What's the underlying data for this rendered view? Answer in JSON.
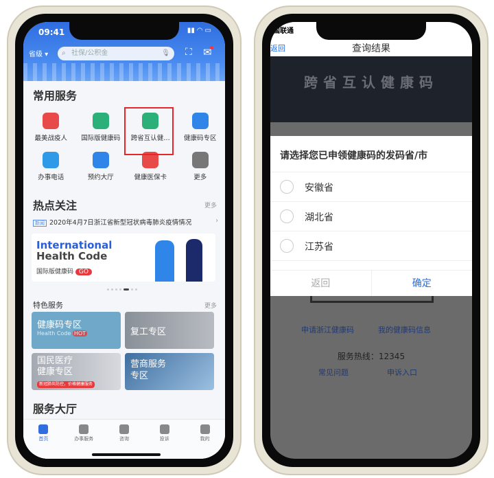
{
  "left": {
    "status_time": "09:41",
    "region": "省级",
    "search_placeholder": "社保/公积金",
    "common_title": "常用服务",
    "services": [
      {
        "label": "最美战疫人",
        "icon": "medal-icon",
        "color": "#e84a4a"
      },
      {
        "label": "国际版健康码",
        "icon": "qr-code-icon",
        "color": "#2bb07a"
      },
      {
        "label": "跨省互认健…",
        "icon": "qr-shield-icon",
        "color": "#2bb07a",
        "highlighted": true
      },
      {
        "label": "健康码专区",
        "icon": "qr-code-blue-icon",
        "color": "#2f86e8"
      },
      {
        "label": "办事电话",
        "icon": "clipboard-icon",
        "color": "#2f9ae8"
      },
      {
        "label": "预约大厅",
        "icon": "building-clock-icon",
        "color": "#2f86e8"
      },
      {
        "label": "健康医保卡",
        "icon": "heart-pulse-icon",
        "color": "#e84a4a"
      },
      {
        "label": "更多",
        "icon": "grid-icon",
        "color": "#777"
      }
    ],
    "hot_title": "热点关注",
    "more": "更多",
    "news_tag": "新闻",
    "news_text": "2020年4月7日浙江省新型冠状病毒肺炎疫情情况",
    "banner": {
      "line1": "International",
      "line2": "Health Code",
      "sub": "国际版健康码",
      "go": "GO"
    },
    "carousel_active": 5,
    "carousel_count": 7,
    "featured_title": "特色服务",
    "cards": [
      {
        "title": "健康码专区",
        "sub": "Health Code",
        "badge": "HOT"
      },
      {
        "title": "复工专区"
      },
      {
        "title": "国民医疗\n健康专区",
        "badge": "新冠肺炎防控，价格健康服务"
      },
      {
        "title": "营商服务\n专区"
      }
    ],
    "hall_title": "服务大厅",
    "tabs": [
      "首页",
      "办事服务",
      "咨询",
      "投诉",
      "我的"
    ],
    "highlight_color": "#e8262a",
    "accent": "#2f6de0"
  },
  "right": {
    "carrier": "国联通",
    "back": "返回",
    "title": "查询结果",
    "banner_text": "跨省互认健康码",
    "dialog_title": "请选择您已申领健康码的发码省/市",
    "options": [
      "安徽省",
      "湖北省",
      "江苏省"
    ],
    "cancel": "返回",
    "confirm": "确定",
    "link1": "申请浙江健康码",
    "link2": "我的健康码信息",
    "hotline": "服务热线：12345",
    "link3": "常见问题",
    "link4": "申诉入口"
  }
}
